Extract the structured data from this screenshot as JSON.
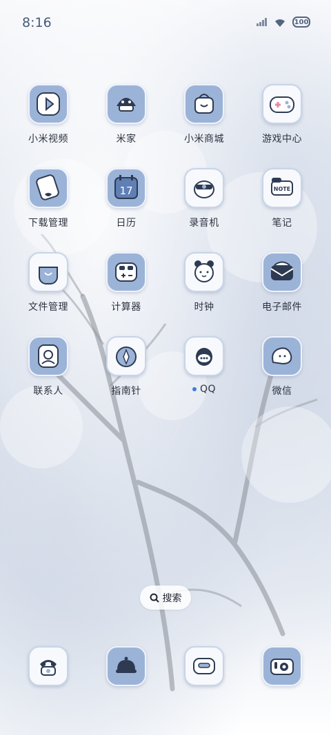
{
  "status": {
    "time": "8:16",
    "battery": "100"
  },
  "apps": [
    {
      "label": "小米视频",
      "icon": "video-play-icon"
    },
    {
      "label": "米家",
      "icon": "smart-home-icon"
    },
    {
      "label": "小米商城",
      "icon": "shopping-bag-icon"
    },
    {
      "label": "游戏中心",
      "icon": "gamepad-icon"
    },
    {
      "label": "下载管理",
      "icon": "download-icon"
    },
    {
      "label": "日历",
      "icon": "calendar-icon",
      "date": "17"
    },
    {
      "label": "录音机",
      "icon": "recorder-icon"
    },
    {
      "label": "笔记",
      "icon": "note-icon",
      "badge_text": "NOTE"
    },
    {
      "label": "文件管理",
      "icon": "folder-icon"
    },
    {
      "label": "计算器",
      "icon": "calculator-icon"
    },
    {
      "label": "时钟",
      "icon": "clock-icon"
    },
    {
      "label": "电子邮件",
      "icon": "mail-icon"
    },
    {
      "label": "联系人",
      "icon": "contacts-icon"
    },
    {
      "label": "指南针",
      "icon": "compass-icon"
    },
    {
      "label": "QQ",
      "icon": "qq-icon",
      "has_new_dot": true
    },
    {
      "label": "微信",
      "icon": "wechat-icon"
    }
  ],
  "search": {
    "label": "搜索"
  },
  "dock": [
    {
      "icon": "phone-icon"
    },
    {
      "icon": "messages-icon"
    },
    {
      "icon": "browser-icon"
    },
    {
      "icon": "camera-icon"
    }
  ],
  "colors": {
    "tile_blue": "#9cb3d8",
    "tile_light": "#f7f9fd",
    "label_text": "#2e3340",
    "dot_blue": "#3b7de0"
  }
}
